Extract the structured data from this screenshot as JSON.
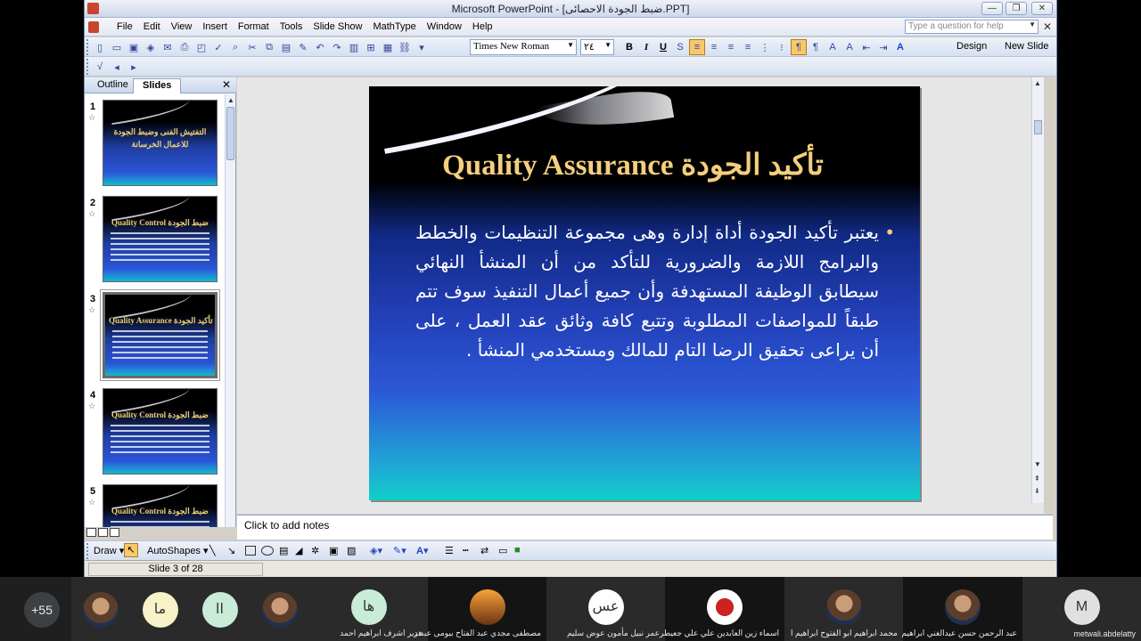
{
  "window": {
    "title": "Microsoft PowerPoint - [ضبط الجودة الاحصائى.PPT]",
    "help_placeholder": "Type a question for help"
  },
  "menu": [
    "File",
    "Edit",
    "View",
    "Insert",
    "Format",
    "Tools",
    "Slide Show",
    "MathType",
    "Window",
    "Help"
  ],
  "toolbar": {
    "font_name": "Times New Roman",
    "font_size": "٢٤",
    "bold": "B",
    "italic": "I",
    "underline": "U",
    "design_label": "Design",
    "new_slide_label": "New Slide"
  },
  "pane": {
    "tab_outline": "Outline",
    "tab_slides": "Slides",
    "slides": [
      {
        "num": "1",
        "title": "التفتيش الفنى وضبط الجودة للاعمال الخرسانة"
      },
      {
        "num": "2",
        "title": "Quality Control     ضبط الجودة"
      },
      {
        "num": "3",
        "title": "Quality Assurance  تأكيد الجودة"
      },
      {
        "num": "4",
        "title": "Quality Control     ضبط الجودة"
      },
      {
        "num": "5",
        "title": "Quality Control     ضبط الجودة"
      }
    ]
  },
  "slide": {
    "title_en": "Quality Assurance",
    "title_ar": "تأكيد الجودة",
    "body": "يعتبر تأكيد الجودة أداة إدارة وهى مجموعة التنظيمات والخطط والبرامج اللازمة والضرورية للتأكد من أن المنشأ النهائي سيطابق الوظيفة المستهدفة وأن جميع أعمال التنفيذ سوف تتم طبقاً للمواصفات المطلوبة وتتبع كافة وثائق عقد العمل ، على أن يراعى تحقيق الرضا التام للمالك ومستخدمي المنشأ ."
  },
  "notes_placeholder": "Click to add notes",
  "drawbar": {
    "draw": "Draw",
    "autoshapes": "AutoShapes"
  },
  "status": "Slide 3 of 28",
  "participants": {
    "count": "+55",
    "tiles": [
      {
        "initials": "",
        "name": "",
        "style": "photo"
      },
      {
        "initials": "ما",
        "name": "",
        "style": "cream"
      },
      {
        "initials": "اا",
        "name": "",
        "style": "green"
      },
      {
        "initials": "",
        "name": "",
        "style": "photo"
      },
      {
        "initials": "ها",
        "name": "هدير اشرف ابراهيم احمد",
        "style": "green"
      },
      {
        "initials": "",
        "name": "مصطفى مجدي عبد الفتاح بيومى عبد ر",
        "style": "pyramid"
      },
      {
        "initials": "عس",
        "name": "عمر نبيل مأمون عوض سليم",
        "style": "white"
      },
      {
        "initials": "",
        "name": "اسماء زين العابدين علي علي جعيطر",
        "style": "bow"
      },
      {
        "initials": "",
        "name": "محمد ابراهيم ابو الفتوح ابراهيم ا",
        "style": "photo"
      },
      {
        "initials": "",
        "name": "عبد الرحمن حسن عبدالغني ابراهيم",
        "style": "photo"
      },
      {
        "initials": "M",
        "name": "metwali.abdelatty",
        "style": "gray"
      }
    ]
  }
}
